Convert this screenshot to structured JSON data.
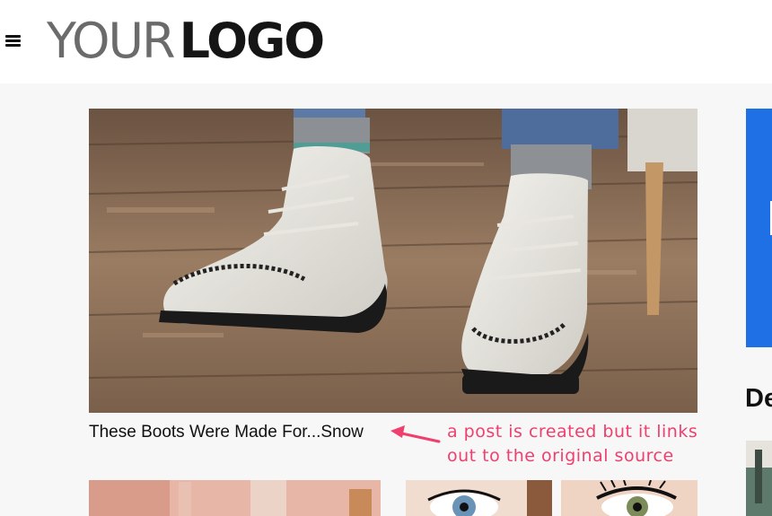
{
  "header": {
    "logo_light": "YOUR",
    "logo_bold": "LOGO"
  },
  "main": {
    "featured_post_title": "These Boots Were Made For...Snow"
  },
  "annotation": {
    "line1": "a post is created but it links",
    "line2": "out to the original source",
    "color": "#ef3f6e"
  },
  "sidebar": {
    "heading": "De",
    "accent_color": "#1f6fe5"
  },
  "icons": {
    "menu": "hamburger-menu-icon",
    "annotation_arrow": "arrow-left-icon"
  }
}
